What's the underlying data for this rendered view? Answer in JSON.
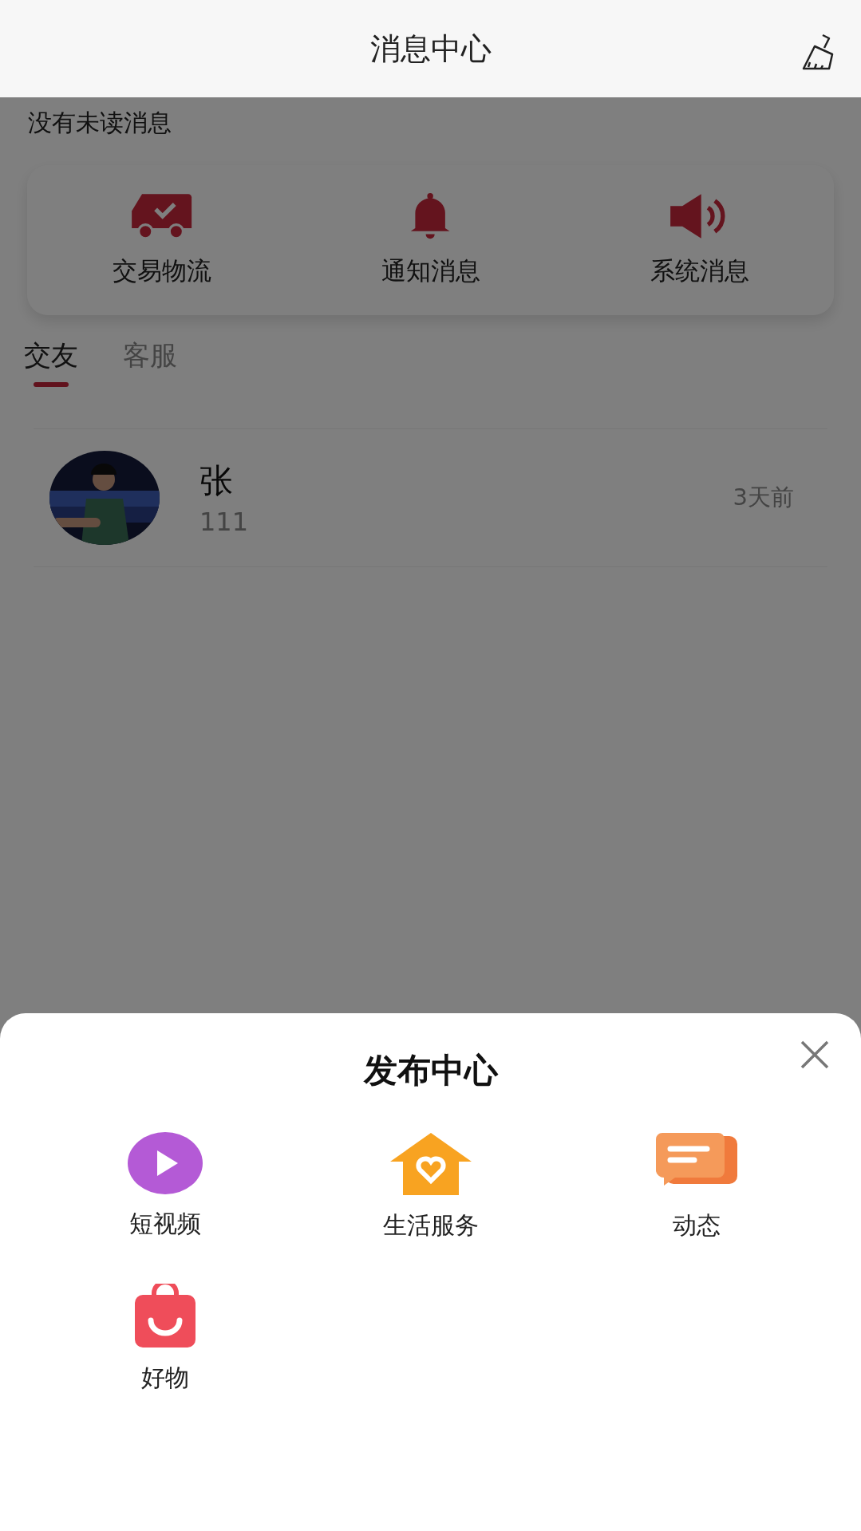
{
  "header": {
    "title": "消息中心"
  },
  "status": "没有未读消息",
  "quick_actions": [
    {
      "label": "交易物流"
    },
    {
      "label": "通知消息"
    },
    {
      "label": "系统消息"
    }
  ],
  "tabs": [
    {
      "label": "交友",
      "selected": true
    },
    {
      "label": "客服",
      "selected": false
    }
  ],
  "conversations": [
    {
      "name": "张",
      "preview": "111",
      "time": "3天前"
    }
  ],
  "publish_sheet": {
    "title": "发布中心",
    "items": [
      {
        "label": "短视频"
      },
      {
        "label": "生活服务"
      },
      {
        "label": "动态"
      },
      {
        "label": "好物"
      }
    ]
  }
}
